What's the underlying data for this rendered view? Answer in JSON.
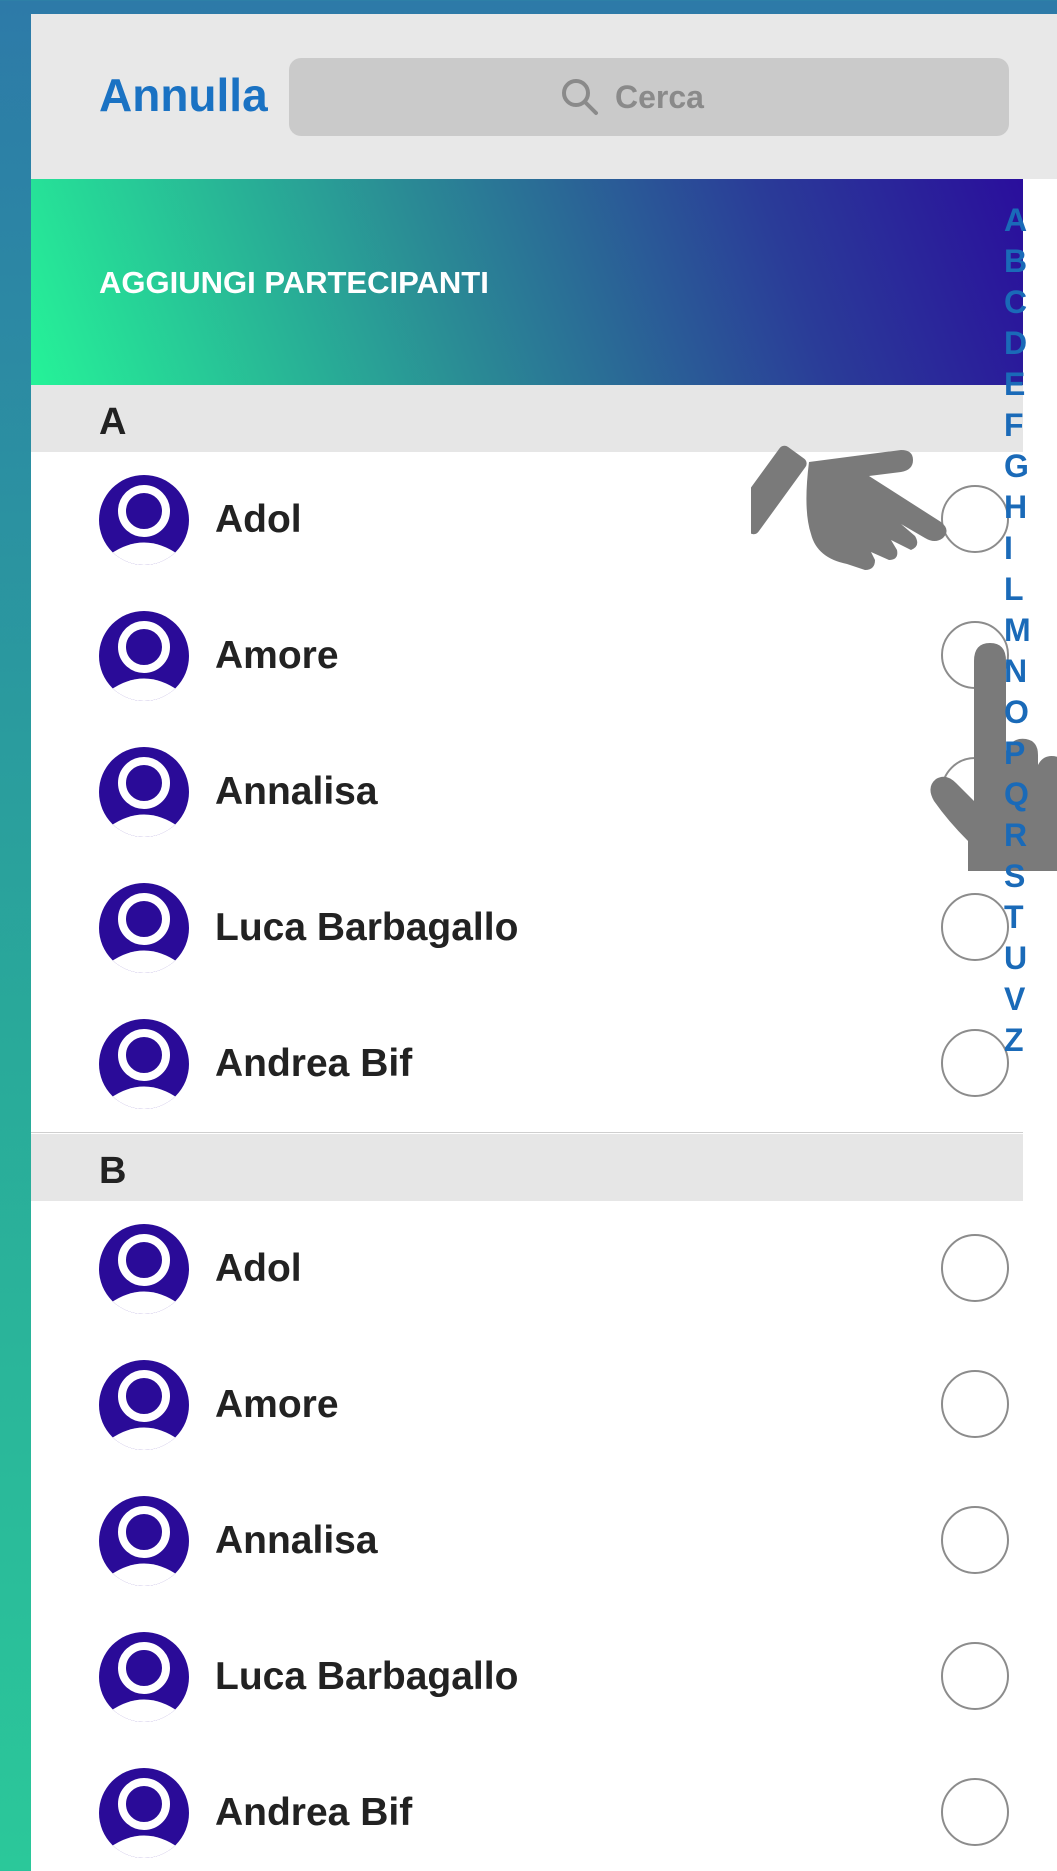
{
  "header": {
    "cancel_label": "Annulla",
    "search_placeholder": "Cerca"
  },
  "banner": {
    "title": "AGGIUNGI PARTECIPANTI"
  },
  "sections": [
    {
      "letter": "A",
      "contacts": [
        "Adol",
        "Amore",
        "Annalisa",
        "Luca Barbagallo",
        "Andrea Bif"
      ]
    },
    {
      "letter": "B",
      "contacts": [
        "Adol",
        "Amore",
        "Annalisa",
        "Luca Barbagallo",
        "Andrea Bif"
      ]
    }
  ],
  "alphabet_index": [
    "A",
    "B",
    "C",
    "D",
    "E",
    "F",
    "G",
    "H",
    "I",
    "L",
    "M",
    "N",
    "O",
    "P",
    "Q",
    "R",
    "S",
    "T",
    "U",
    "V",
    "Z"
  ],
  "colors": {
    "accent": "#1a72c3",
    "avatar": "#2a0b98",
    "banner_start": "#25f398",
    "banner_end": "#2a0e9c"
  },
  "icons": {
    "search": "search-icon",
    "avatar": "person-avatar-icon",
    "pointing_hand": "pointing-hand-icon",
    "tap_hand": "tap-hand-icon"
  }
}
